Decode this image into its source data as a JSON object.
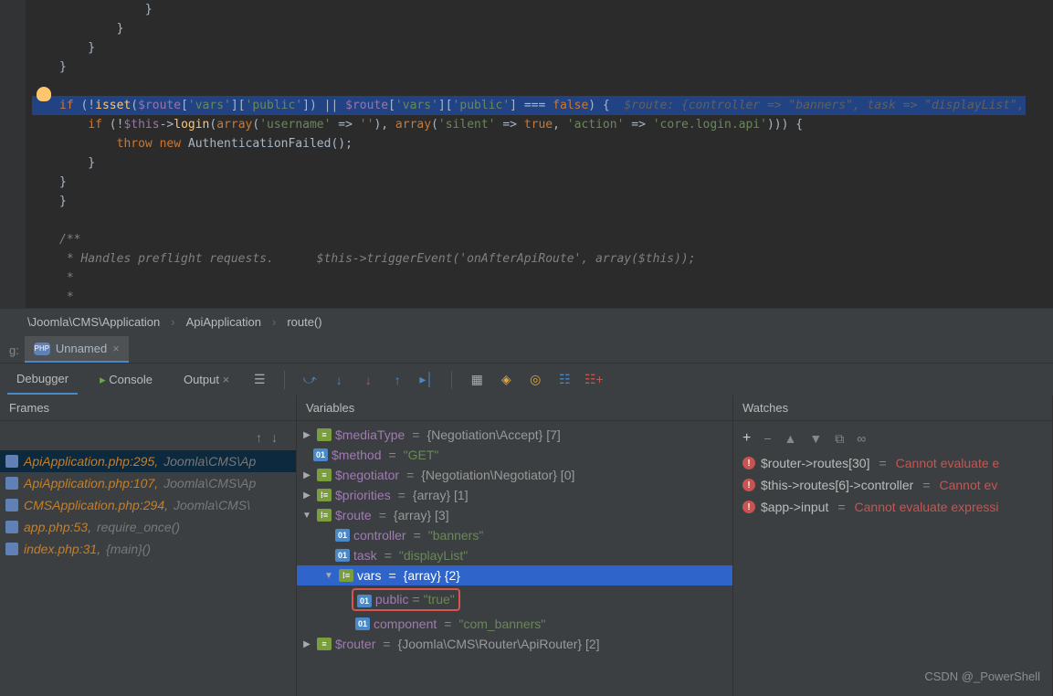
{
  "breadcrumb": {
    "path": "\\Joomla\\CMS\\Application",
    "class": "ApiApplication",
    "method": "route()"
  },
  "run": {
    "prefix": "g:",
    "config": "Unnamed"
  },
  "tabs": {
    "debugger": "Debugger",
    "console": "Console",
    "output": "Output"
  },
  "panels": {
    "frames": "Frames",
    "variables": "Variables",
    "watches": "Watches"
  },
  "frames": [
    {
      "file": "ApiApplication.php",
      "line": 295,
      "ns": "Joomla\\CMS\\Ap",
      "sel": true
    },
    {
      "file": "ApiApplication.php",
      "line": 107,
      "ns": "Joomla\\CMS\\Ap",
      "sel": false
    },
    {
      "file": "CMSApplication.php",
      "line": 294,
      "ns": "Joomla\\CMS\\",
      "sel": false
    },
    {
      "file": "app.php",
      "line": 53,
      "fn": "require_once()",
      "sel": false
    },
    {
      "file": "index.php",
      "line": 31,
      "fn": "{main}()",
      "sel": false
    }
  ],
  "vars": {
    "mediaType": {
      "name": "$mediaType",
      "value": "{Negotiation\\Accept} [7]"
    },
    "method": {
      "name": "$method",
      "value": "\"GET\""
    },
    "negotiator": {
      "name": "$negotiator",
      "value": "{Negotiation\\Negotiator} [0]"
    },
    "priorities": {
      "name": "$priorities",
      "value": "{array} [1]"
    },
    "route": {
      "name": "$route",
      "value": "{array} [3]"
    },
    "controller": {
      "name": "controller",
      "value": "\"banners\""
    },
    "task": {
      "name": "task",
      "value": "\"displayList\""
    },
    "varsarr": {
      "name": "vars",
      "value": "{array} {2}"
    },
    "public": {
      "name": "public",
      "value": "\"true\""
    },
    "component": {
      "name": "component",
      "value": "\"com_banners\""
    },
    "router": {
      "name": "$router",
      "value": "{Joomla\\CMS\\Router\\ApiRouter} [2]"
    }
  },
  "watches": [
    {
      "expr": "$router->routes[30]",
      "err": "Cannot evaluate e"
    },
    {
      "expr": "$this->routes[6]->controller",
      "err": "Cannot ev"
    },
    {
      "expr": "$app->input",
      "err": "Cannot evaluate expressi"
    }
  ],
  "code": {
    "hl_inlay": "  $route: {controller => \"banners\", task => \"displayList\","
  },
  "watermark": "CSDN @_PowerShell"
}
